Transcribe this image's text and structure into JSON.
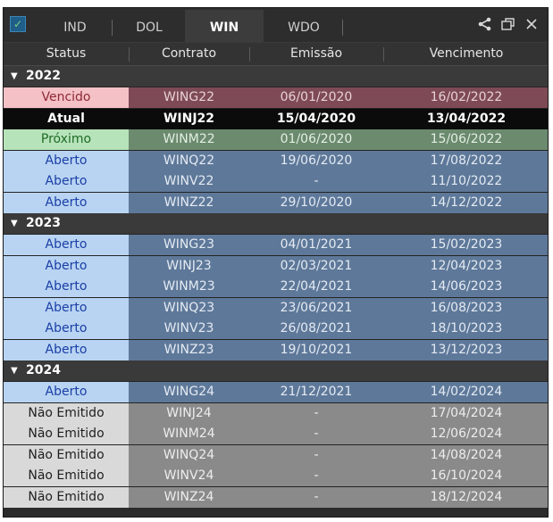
{
  "tabs": [
    {
      "label": "IND",
      "active": false
    },
    {
      "label": "DOL",
      "active": false
    },
    {
      "label": "WIN",
      "active": true
    },
    {
      "label": "WDO",
      "active": false
    }
  ],
  "controls": {
    "share_icon": "share-icon",
    "popout_icon": "popout-icon",
    "close_icon": "close-icon"
  },
  "columns": [
    "Status",
    "Contrato",
    "Emissão",
    "Vencimento"
  ],
  "groups": [
    {
      "year": "2022",
      "rows": [
        {
          "theme": "vencido",
          "status": "Vencido",
          "contrato": "WING22",
          "emissao": "06/01/2020",
          "vencimento": "16/02/2022"
        },
        {
          "theme": "atual",
          "status": "Atual",
          "contrato": "WINJ22",
          "emissao": "15/04/2020",
          "vencimento": "13/04/2022"
        },
        {
          "theme": "proximo",
          "status": "Próximo",
          "contrato": "WINM22",
          "emissao": "01/06/2020",
          "vencimento": "15/06/2022"
        },
        {
          "theme": "aberto",
          "status": "Aberto",
          "contrato": "WINQ22",
          "emissao": "19/06/2020",
          "vencimento": "17/08/2022"
        },
        {
          "theme": "aberto",
          "status": "Aberto",
          "contrato": "WINV22",
          "emissao": "-",
          "vencimento": "11/10/2022"
        },
        {
          "theme": "aberto",
          "status": "Aberto",
          "contrato": "WINZ22",
          "emissao": "29/10/2020",
          "vencimento": "14/12/2022"
        }
      ]
    },
    {
      "year": "2023",
      "rows": [
        {
          "theme": "aberto",
          "status": "Aberto",
          "contrato": "WING23",
          "emissao": "04/01/2021",
          "vencimento": "15/02/2023"
        },
        {
          "theme": "aberto",
          "status": "Aberto",
          "contrato": "WINJ23",
          "emissao": "02/03/2021",
          "vencimento": "12/04/2023"
        },
        {
          "theme": "aberto",
          "status": "Aberto",
          "contrato": "WINM23",
          "emissao": "22/04/2021",
          "vencimento": "14/06/2023"
        },
        {
          "theme": "aberto",
          "status": "Aberto",
          "contrato": "WINQ23",
          "emissao": "23/06/2021",
          "vencimento": "16/08/2023"
        },
        {
          "theme": "aberto",
          "status": "Aberto",
          "contrato": "WINV23",
          "emissao": "26/08/2021",
          "vencimento": "18/10/2023"
        },
        {
          "theme": "aberto",
          "status": "Aberto",
          "contrato": "WINZ23",
          "emissao": "19/10/2021",
          "vencimento": "13/12/2023"
        }
      ]
    },
    {
      "year": "2024",
      "rows": [
        {
          "theme": "aberto",
          "status": "Aberto",
          "contrato": "WING24",
          "emissao": "21/12/2021",
          "vencimento": "14/02/2024"
        },
        {
          "theme": "nao",
          "status": "Não Emitido",
          "contrato": "WINJ24",
          "emissao": "-",
          "vencimento": "17/04/2024"
        },
        {
          "theme": "nao",
          "status": "Não Emitido",
          "contrato": "WINM24",
          "emissao": "-",
          "vencimento": "12/06/2024"
        },
        {
          "theme": "nao",
          "status": "Não Emitido",
          "contrato": "WINQ24",
          "emissao": "-",
          "vencimento": "14/08/2024"
        },
        {
          "theme": "nao",
          "status": "Não Emitido",
          "contrato": "WINV24",
          "emissao": "-",
          "vencimento": "16/10/2024"
        },
        {
          "theme": "nao",
          "status": "Não Emitido",
          "contrato": "WINZ24",
          "emissao": "-",
          "vencimento": "18/12/2024"
        }
      ]
    }
  ],
  "colors": {
    "vencido_status_bg": "#f4c1c6",
    "atual_bg": "#0b0b0b",
    "proximo_status_bg": "#b7e3ba",
    "aberto_status_bg": "#b8d4f2",
    "nao_emitido_status_bg": "#d9d9d9"
  }
}
